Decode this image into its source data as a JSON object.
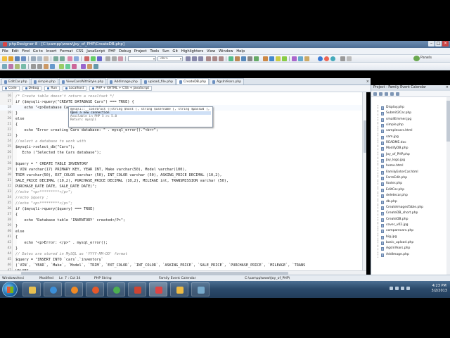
{
  "window": {
    "title": "phpDesigner 8 - [C:\\xampp\\www\\Joy_of_PHP\\CreateDB.php]"
  },
  "menu": [
    "File",
    "Edit",
    "Find",
    "Go to",
    "Insert",
    "Format",
    "CSS",
    "JavaScript",
    "PHP",
    "Debug",
    "Project",
    "Tools",
    "Svn",
    "Git",
    "Highlighters",
    "View",
    "Window",
    "Help"
  ],
  "toolbar": {
    "combo1": "",
    "combo2": "<br>",
    "panels_label": "Panels"
  },
  "tabs": [
    {
      "label": "EditCar.php"
    },
    {
      "label": "simple.php"
    },
    {
      "label": "ViewCarsWithStyle.php"
    },
    {
      "label": "AddImage.php"
    },
    {
      "label": "upload_file.php"
    },
    {
      "label": "CreateDB.php",
      "active": true
    },
    {
      "label": "AgsInYears.php"
    }
  ],
  "editor_toolbar": [
    "Code",
    "Debug",
    "Run",
    "Localhost",
    "PHP + XHTML + CSS + JavaScript"
  ],
  "code_lines": [
    {
      "n": "16",
      "cls": "c-com",
      "text": "/* Create table doesn't return a resultset */"
    },
    {
      "n": "17",
      "cls": "c-plain",
      "text": "if ($mysqli->query(\"CREATE DATABASE Cars\") === TRUE) {"
    },
    {
      "n": "18",
      "cls": "c-plain",
      "text": "    echo \"<p>Database Cars created</p>\";"
    },
    {
      "n": "19",
      "cls": "c-plain",
      "text": "}"
    },
    {
      "n": "20",
      "cls": "c-plain",
      "text": "else"
    },
    {
      "n": "21",
      "cls": "c-plain",
      "text": "{"
    },
    {
      "n": "22",
      "cls": "c-plain",
      "text": "    echo \"Error creating Cars database: \" . mysql_error().\"<br>\";"
    },
    {
      "n": "23",
      "cls": "c-plain",
      "text": "}"
    },
    {
      "n": "24",
      "cls": "c-com",
      "text": "//select a database to work with"
    },
    {
      "n": "25",
      "cls": "c-plain",
      "text": "$mysqli->select_db(\"Cars\");"
    },
    {
      "n": "26",
      "cls": "c-plain",
      "text": "   Echo (\"Selected the Cars database\");"
    },
    {
      "n": "27",
      "cls": "c-plain",
      "text": ""
    },
    {
      "n": "28",
      "cls": "c-plain",
      "text": "$query = \" CREATE TABLE INVENTORY"
    },
    {
      "n": "29",
      "cls": "c-plain",
      "text": "( VIN varchar(17) PRIMARY KEY, YEAR INT, Make varchar(50), Model varchar(100),"
    },
    {
      "n": "30",
      "cls": "c-plain",
      "text": "TRIM varchar(50), EXT_COLOR varchar (50), INT_COLOR varchar (50), ASKING_PRICE DECIMAL (10,2),"
    },
    {
      "n": "31",
      "cls": "c-plain",
      "text": "SALE_PRICE DECIMAL (10,2), PURCHASE_PRICE DECIMAL (10,2), MILEAGE int, TRANSMISSION varchar (50),"
    },
    {
      "n": "32",
      "cls": "c-plain",
      "text": "PURCHASE_DATE DATE, SALE_DATE DATE)\";"
    },
    {
      "n": "33",
      "cls": "c-com",
      "text": "//echo \"<p>*********</p>\";"
    },
    {
      "n": "34",
      "cls": "c-com",
      "text": "//echo $query ;"
    },
    {
      "n": "35",
      "cls": "c-com",
      "text": "//echo \"<p>*********</p>\";"
    },
    {
      "n": "36",
      "cls": "c-plain",
      "text": "if ($mysqli->query($query) === TRUE)"
    },
    {
      "n": "37",
      "cls": "c-plain",
      "text": "{"
    },
    {
      "n": "38",
      "cls": "c-plain",
      "text": "    echo \"Database table 'INVENTORY' created</P>\";"
    },
    {
      "n": "39",
      "cls": "c-plain",
      "text": "}"
    },
    {
      "n": "40",
      "cls": "c-plain",
      "text": "else"
    },
    {
      "n": "41",
      "cls": "c-plain",
      "text": "{"
    },
    {
      "n": "42",
      "cls": "c-plain",
      "text": "    echo \"<p>Error: </p>\" . mysql_error();"
    },
    {
      "n": "43",
      "cls": "c-plain",
      "text": "}"
    },
    {
      "n": "44",
      "cls": "c-com",
      "text": "// Dates are stored in MySQL as 'YYYY-MM-DD' format"
    },
    {
      "n": "45",
      "cls": "c-plain",
      "text": "$query = \"INSERT INTO `cars`.`inventory`"
    },
    {
      "n": "46",
      "cls": "c-plain",
      "text": "(`VIN`, `YEAR`, `Make`, `Model`, `TRIM`, `EXT_COLOR`, `INT_COLOR`, `ASKING_PRICE`, `SALE_PRICE`, `PURCHASE_PRICE`, `MILEAGE`, `TRANS"
    },
    {
      "n": "47",
      "cls": "c-plain",
      "text": "VALUES"
    },
    {
      "n": "48",
      "cls": "c-plain",
      "text": "('5FNYF4H91CB054036', '2012', 'Honda', 'Pilot', 'Touring', 'White Diamond Pearl', 'Leather', '37807', NULL, '34250', '7076', 'Automa"
    }
  ],
  "autocomplete": {
    "signature": "mysqli::__construct ([string $host [, string $username [, string $passwd [, string $dbname [, int $port",
    "rows": [
      "Open a new connection",
      "Available in PHP 5 >= 5.0",
      "Return: mysqli"
    ]
  },
  "project": {
    "header": "Project - Family Event Calendar",
    "files": [
      "Display.php",
      "Submit2Car.php",
      "smallEmmer.jpg",
      "simple.php",
      "samplecars.html",
      "sam.jpg",
      "README.doc",
      "ModifyDB.php",
      "Joy_of_PHP.php",
      "Joy_logo.jpg",
      "home.html",
      "FamilyEnterCar.html",
      "FormEdit.php",
      "footer.php",
      "EditCar.php",
      "deletecar.php",
      "db.php",
      "CreateImagesTable.php",
      "CreateDB_short.php",
      "CreateDB.php",
      "cover_v02.jpg",
      "comparecars.php",
      "big.jpg",
      "basic_upload.php",
      "AgsInYears.php",
      "AddImage.php"
    ]
  },
  "status": {
    "os": "Windows",
    "encoding": "Ansi",
    "modified": "Modified",
    "insert": "Ln",
    "position": "7 : Col 34",
    "php_string": "PHP String",
    "project": "Family Event Calendar",
    "path": "C:\\xampp\\www\\Joy_of_PHP\\"
  },
  "clock": {
    "time": "4:23 PM",
    "date": "3/2/2013"
  }
}
